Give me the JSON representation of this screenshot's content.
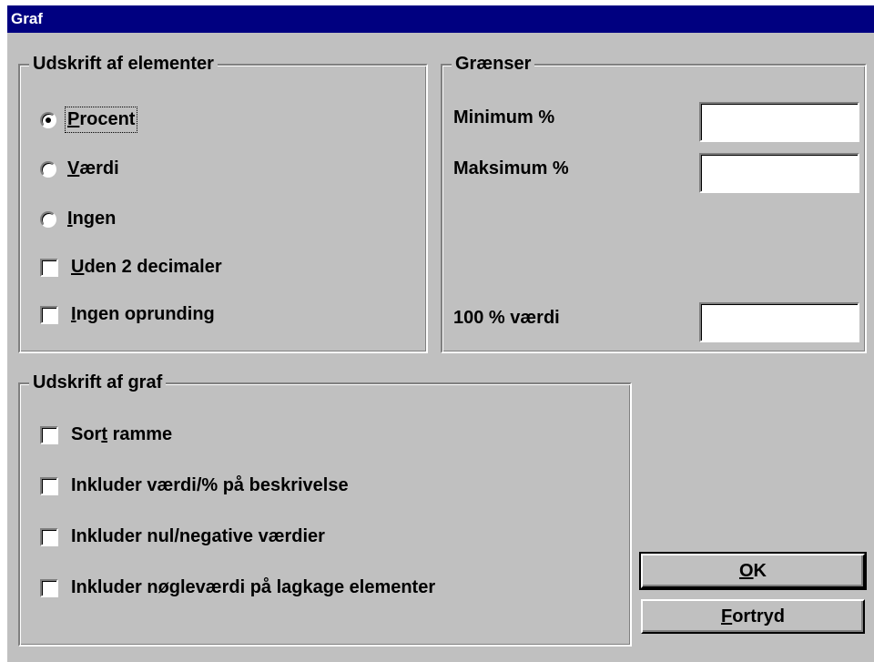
{
  "window": {
    "title": "Graf"
  },
  "elements_group": {
    "legend": "Udskrift af elementer",
    "options": [
      {
        "mnemonic": "P",
        "rest": "rocent",
        "selected": true
      },
      {
        "mnemonic": "V",
        "rest": "ærdi",
        "selected": false
      },
      {
        "mnemonic": "I",
        "rest": "ngen",
        "selected": false
      }
    ],
    "checks": [
      {
        "mnemonic": "U",
        "rest": "den 2 decimaler",
        "checked": false
      },
      {
        "mnemonic": "I",
        "rest": "ngen oprunding",
        "checked": false
      }
    ]
  },
  "limits_group": {
    "legend": "Grænser",
    "min_label": "Minimum %",
    "max_label": "Maksimum %",
    "hundred_label": "100 % værdi",
    "min_value": "",
    "max_value": "",
    "hundred_value": ""
  },
  "graph_group": {
    "legend": "Udskrift af graf",
    "checks": [
      {
        "pre": "Sor",
        "mnemonic": "t",
        "rest": " ramme",
        "checked": false
      },
      {
        "pre": "",
        "mnemonic": "",
        "rest": "Inkluder værdi/% på beskrivelse",
        "checked": false
      },
      {
        "pre": "",
        "mnemonic": "",
        "rest": "Inkluder nul/negative værdier",
        "checked": false
      },
      {
        "pre": "",
        "mnemonic": "",
        "rest": "Inkluder nøgleværdi på lagkage elementer",
        "checked": false
      }
    ]
  },
  "buttons": {
    "ok_mnemonic": "O",
    "ok_rest": "K",
    "cancel_mnemonic": "F",
    "cancel_rest": "ortryd"
  }
}
